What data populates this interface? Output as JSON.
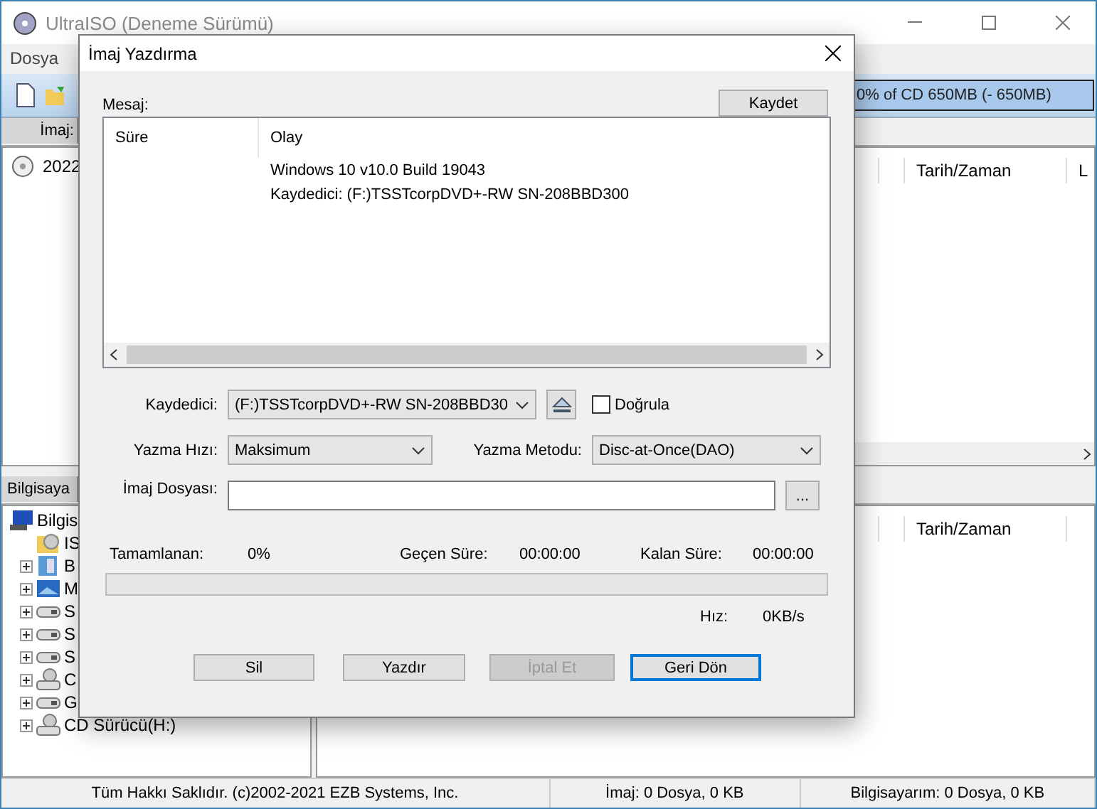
{
  "window": {
    "title": "UltraISO (Deneme Sürümü)",
    "active": false
  },
  "menu": [
    "Dosya"
  ],
  "capacity": {
    "text": "0% of CD 650MB (- 650MB)",
    "level": 0
  },
  "image_header": {
    "label": "İmaj:"
  },
  "image_list": {
    "items": [
      "2022"
    ],
    "columns": [
      "Tarih/Zaman",
      "L"
    ]
  },
  "computer_header": {
    "label": "Bilgisaya"
  },
  "tree": [
    {
      "label": "Bilgis",
      "kind": "computer",
      "children": [
        {
          "label": "IS",
          "kind": "iso",
          "expandable": false
        },
        {
          "label": "B",
          "kind": "book",
          "expandable": true
        },
        {
          "label": "M",
          "kind": "monitor",
          "expandable": true
        },
        {
          "label": "S",
          "kind": "drive",
          "expandable": true
        },
        {
          "label": "S",
          "kind": "drive",
          "expandable": true
        },
        {
          "label": "S",
          "kind": "drive",
          "expandable": true
        },
        {
          "label": "C",
          "kind": "cddrive",
          "expandable": true
        },
        {
          "label": "G",
          "kind": "drive",
          "expandable": true
        },
        {
          "label": "CD Sürücü(H:)",
          "kind": "cddrive",
          "expandable": true
        }
      ]
    }
  ],
  "computer_list": {
    "columns": [
      "Tarih/Zaman"
    ]
  },
  "status_bar": [
    "Tüm Hakkı Saklıdır. (c)2002-2021 EZB Systems, Inc.",
    "İmaj: 0 Dosya, 0 KB",
    "Bilgisayarım: 0 Dosya, 0 KB"
  ],
  "dialog": {
    "title": "İmaj Yazdırma",
    "message_label": "Mesaj:",
    "save_button": "Kaydet",
    "log": {
      "columns": [
        "Süre",
        "Olay"
      ],
      "rows": [
        {
          "event": "Windows 10 v10.0 Build 19043"
        },
        {
          "event": "Kaydedici: (F:)TSSTcorpDVD+-RW SN-208BBD300"
        }
      ]
    },
    "recorder": {
      "label": "Kaydedici:",
      "value": "(F:)TSSTcorpDVD+-RW SN-208BBD30"
    },
    "verify": {
      "label": "Doğrula",
      "checked": false
    },
    "speed": {
      "label": "Yazma Hızı:",
      "value": "Maksimum"
    },
    "method": {
      "label": "Yazma Metodu:",
      "value": "Disc-at-Once(DAO)"
    },
    "image_file": {
      "label": "İmaj Dosyası:",
      "browse": "..."
    },
    "progress": {
      "done_label": "Tamamlanan:",
      "done": "0%",
      "elapsed_label": "Geçen Süre:",
      "elapsed": "00:00:00",
      "remaining_label": "Kalan Süre:",
      "remaining": "00:00:00",
      "level": 0,
      "speed_label": "Hız:",
      "speed": "0KB/s"
    },
    "buttons": [
      {
        "label": "Sil",
        "disabled": false,
        "focused": false
      },
      {
        "label": "Yazdır",
        "disabled": false,
        "focused": false
      },
      {
        "label": "İptal Et",
        "disabled": true,
        "focused": false
      },
      {
        "label": "Geri Dön",
        "disabled": false,
        "focused": true
      }
    ]
  }
}
